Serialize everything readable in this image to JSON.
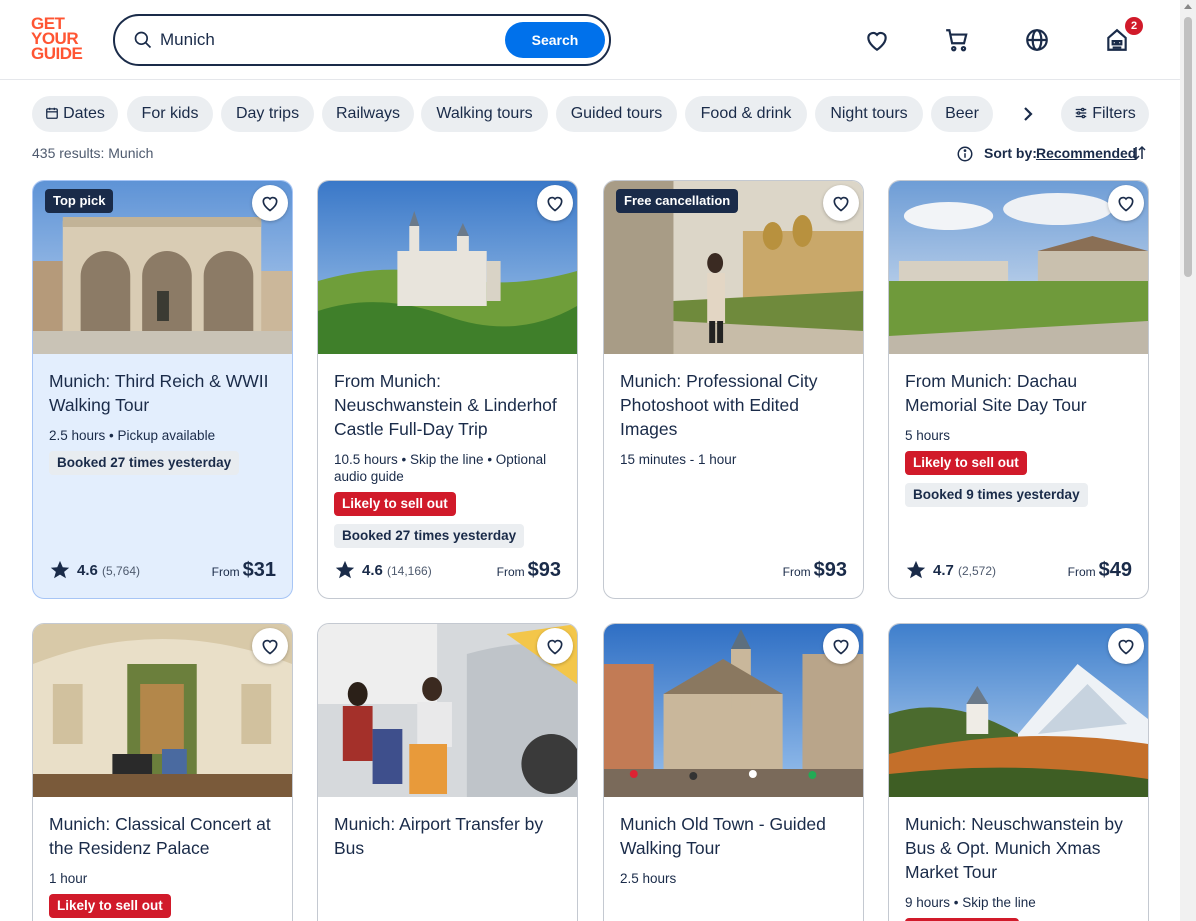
{
  "brand": {
    "line1": "GET",
    "line2": "YOUR",
    "line3": "GUIDE",
    "color": "#ff5533"
  },
  "search": {
    "value": "Munich",
    "button": "Search"
  },
  "header": {
    "cart_count": "2"
  },
  "chips": [
    "Dates",
    "For kids",
    "Day trips",
    "Railways",
    "Walking tours",
    "Guided tours",
    "Food & drink",
    "Night tours",
    "Beer"
  ],
  "filters_label": "Filters",
  "results_text": "435 results: Munich",
  "sort": {
    "label": "Sort by:",
    "value": "Recommended"
  },
  "cards": [
    {
      "badge": "Top pick",
      "title": "Munich: Third Reich & WWII Walking Tour",
      "meta": "2.5 hours • Pickup available",
      "tags": [
        "Booked 27 times yesterday"
      ],
      "rating": "4.6",
      "reviews": "(5,764)",
      "from": "From",
      "price": "$31"
    },
    {
      "title": "From Munich: Neuschwanstein & Linderhof Castle Full-Day Trip",
      "meta": "10.5 hours • Skip the line • Optional audio guide",
      "tags": [
        "Likely to sell out",
        "Booked 27 times yesterday"
      ],
      "rating": "4.6",
      "reviews": "(14,166)",
      "from": "From",
      "price": "$93"
    },
    {
      "badge": "Free cancellation",
      "title": "Munich: Professional City Photoshoot with Edited Images",
      "meta": "15 minutes - 1 hour",
      "from": "From",
      "price": "$93"
    },
    {
      "title": "From Munich: Dachau Memorial Site Day Tour",
      "meta": "5 hours",
      "tags": [
        "Likely to sell out",
        "Booked 9 times yesterday"
      ],
      "rating": "4.7",
      "reviews": "(2,572)",
      "from": "From",
      "price": "$49"
    },
    {
      "title": "Munich: Classical Concert at the Residenz Palace",
      "meta": "1 hour",
      "tags": [
        "Likely to sell out"
      ]
    },
    {
      "title": "Munich: Airport Transfer by Bus"
    },
    {
      "title": "Munich Old Town - Guided Walking Tour",
      "meta": "2.5 hours"
    },
    {
      "title": "Munich: Neuschwanstein by Bus & Opt. Munich Xmas Market Tour",
      "meta": "9 hours • Skip the line"
    }
  ]
}
